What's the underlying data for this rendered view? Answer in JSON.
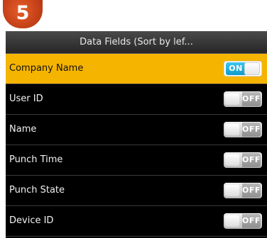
{
  "step_badge": "5",
  "title": "Data Fields (Sort by lef...",
  "rows": [
    {
      "label": "Company Name",
      "state": "ON",
      "selected": true
    },
    {
      "label": "User ID",
      "state": "OFF",
      "selected": false
    },
    {
      "label": "Name",
      "state": "OFF",
      "selected": false
    },
    {
      "label": "Punch Time",
      "state": "OFF",
      "selected": false
    },
    {
      "label": "Punch State",
      "state": "OFF",
      "selected": false
    },
    {
      "label": "Device ID",
      "state": "OFF",
      "selected": false
    }
  ],
  "colors": {
    "selected_row": "#f5b400",
    "on_accent": "#1aa9dc",
    "badge": "#c9431a"
  }
}
